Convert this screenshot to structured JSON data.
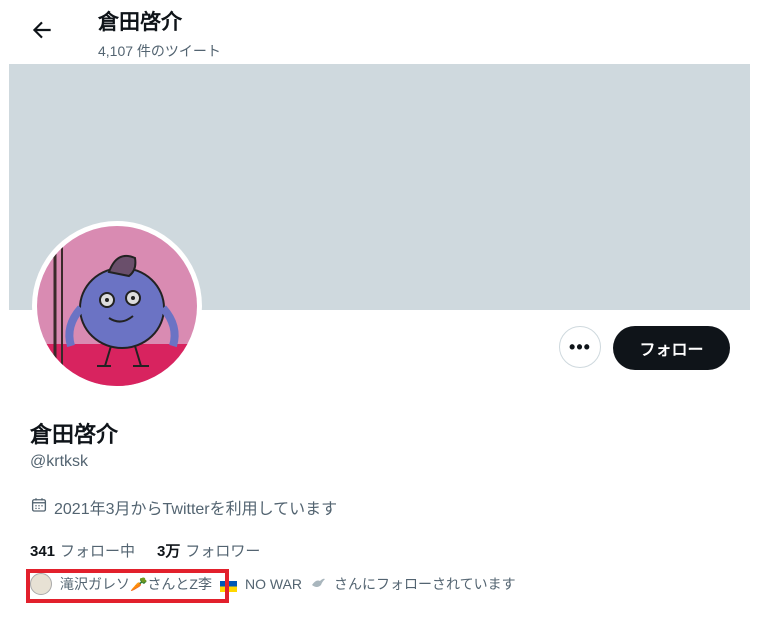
{
  "header": {
    "title": "倉田啓介",
    "tweet_count": "4,107 件のツイート"
  },
  "profile": {
    "name": "倉田啓介",
    "handle": "@krtksk",
    "joined": "2021年3月からTwitterを利用しています",
    "following_count": "341",
    "following_label": "フォロー中",
    "followers_count": "3万",
    "followers_label": "フォロワー"
  },
  "actions": {
    "more_label": "•••",
    "follow_label": "フォロー"
  },
  "mutual": {
    "text_a": "滝沢ガレソ",
    "carrot": "🥕",
    "text_b": "さんとZ李",
    "text_c": "NO WAR",
    "text_d": "さんにフォローされています"
  },
  "colors": {
    "banner": "#cfd9de",
    "follow_button": "#0f1419",
    "highlight": "#e2202c"
  }
}
